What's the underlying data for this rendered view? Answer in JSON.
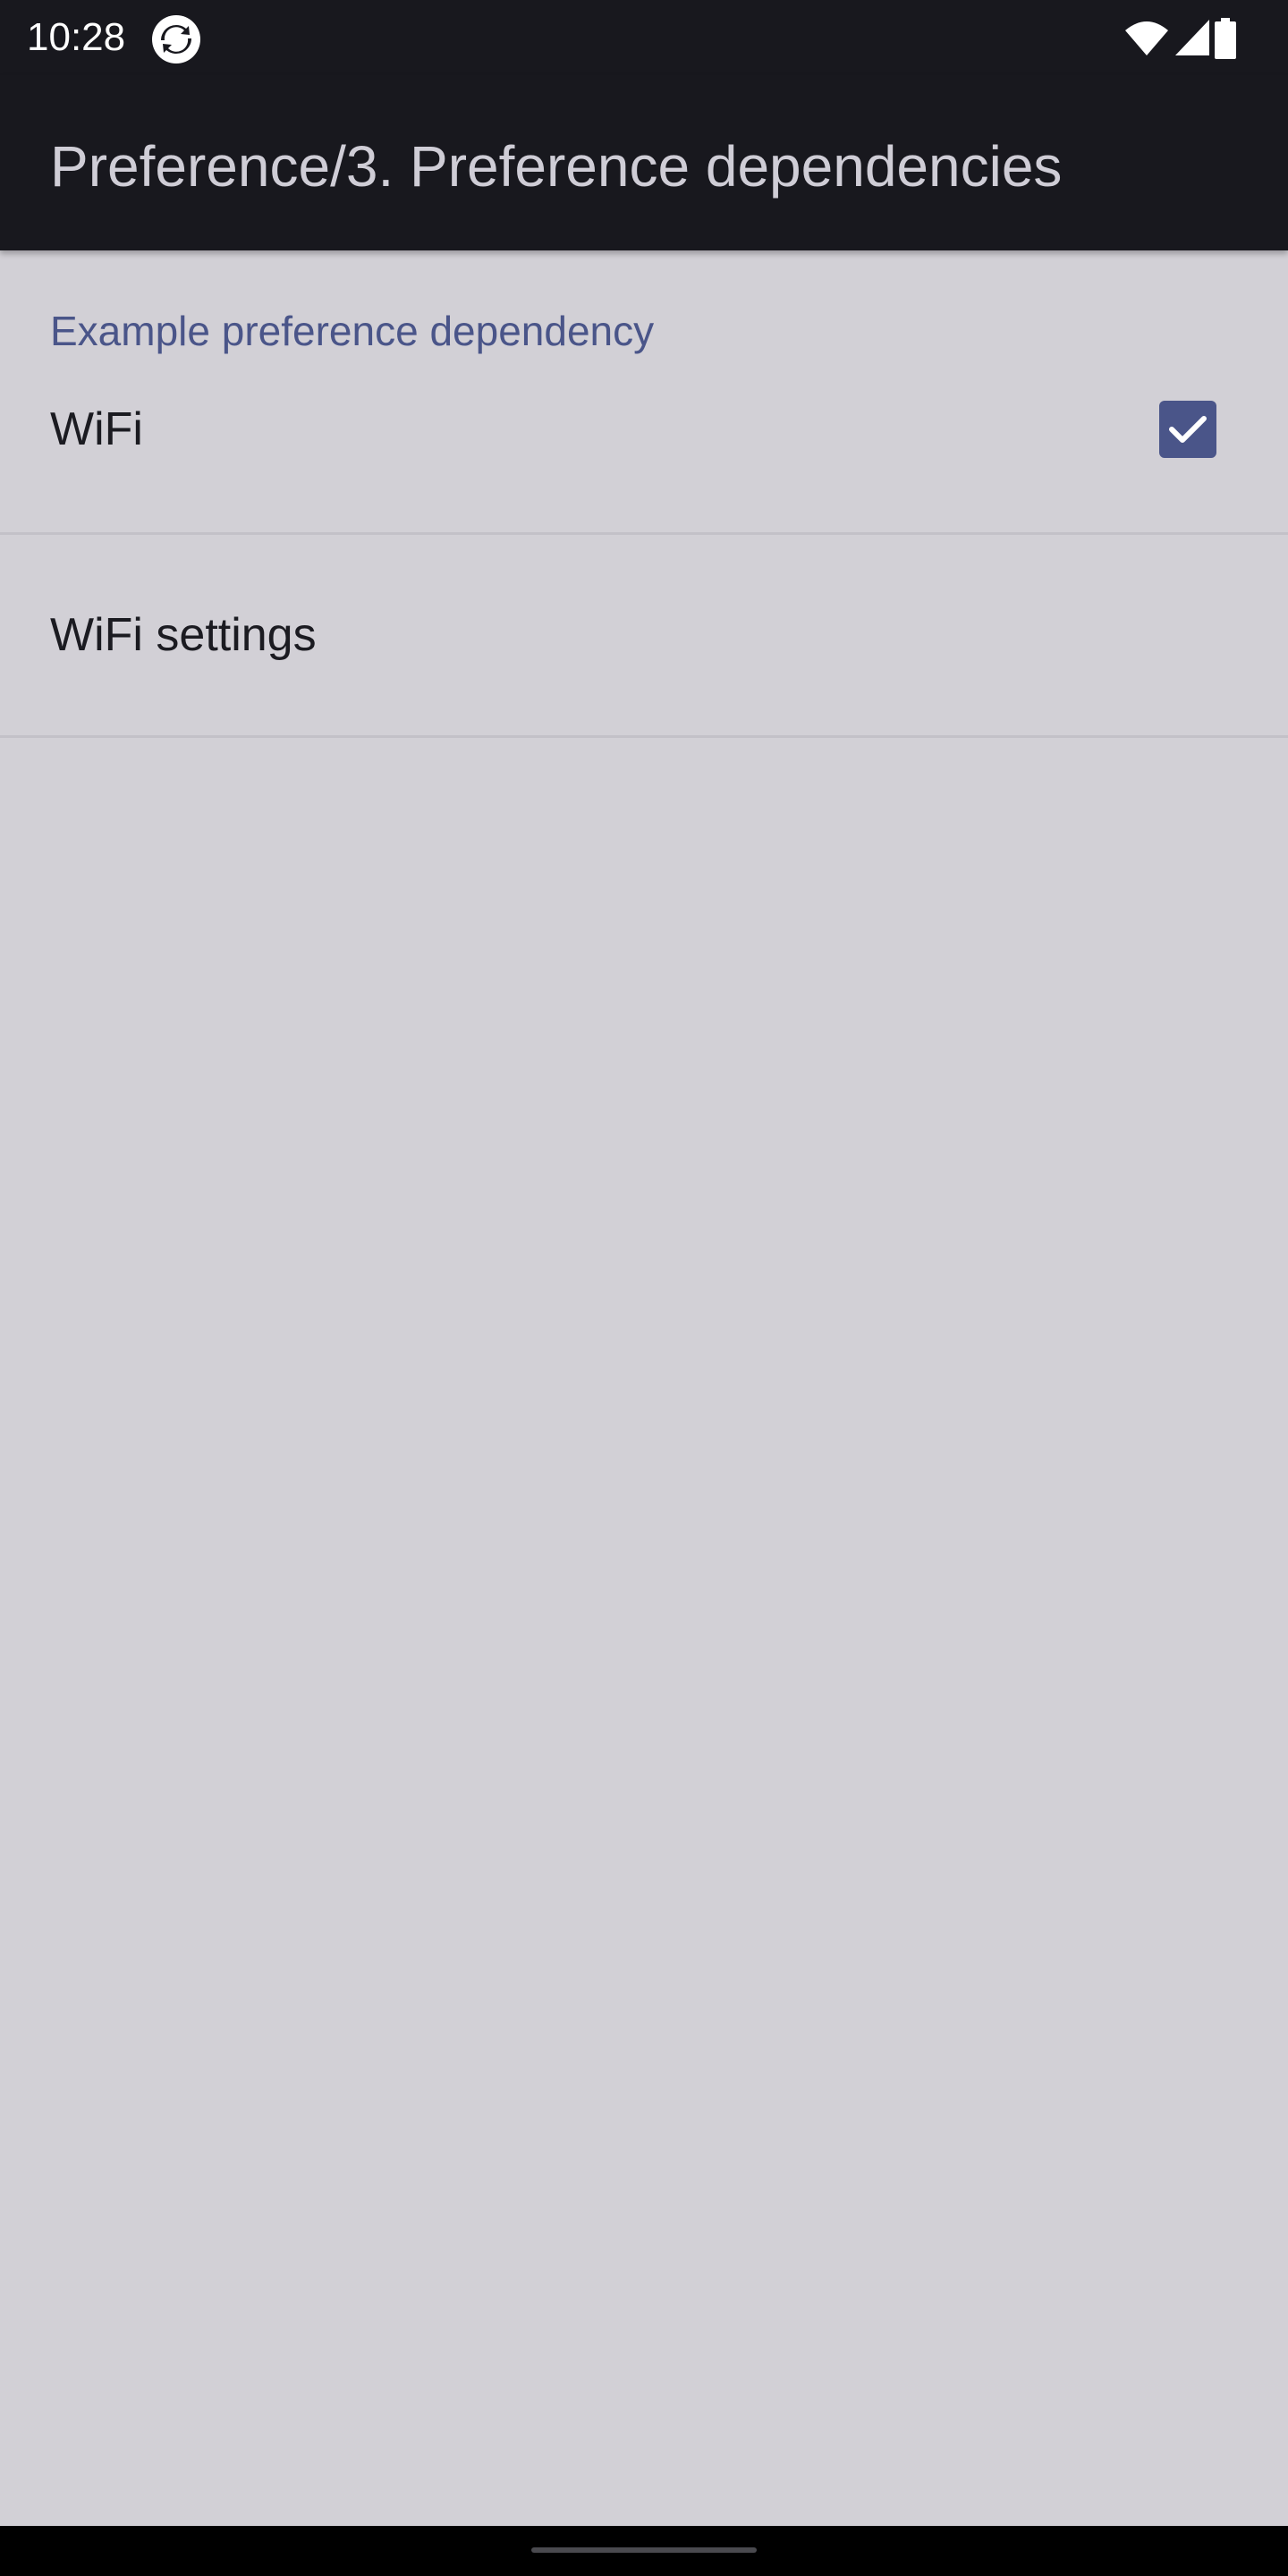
{
  "status_bar": {
    "time": "10:28",
    "icons": [
      "sync-app-icon",
      "wifi-icon",
      "signal-icon",
      "battery-icon"
    ]
  },
  "toolbar": {
    "title": "Preference/3. Preference dependencies"
  },
  "preferences": {
    "category_title": "Example preference dependency",
    "wifi": {
      "title": "WiFi",
      "checked": true
    },
    "wifi_settings": {
      "title": "WiFi settings"
    }
  },
  "colors": {
    "accent": "#4a5589",
    "bar_background": "#18181e",
    "page_background": "#d2d0d6"
  }
}
